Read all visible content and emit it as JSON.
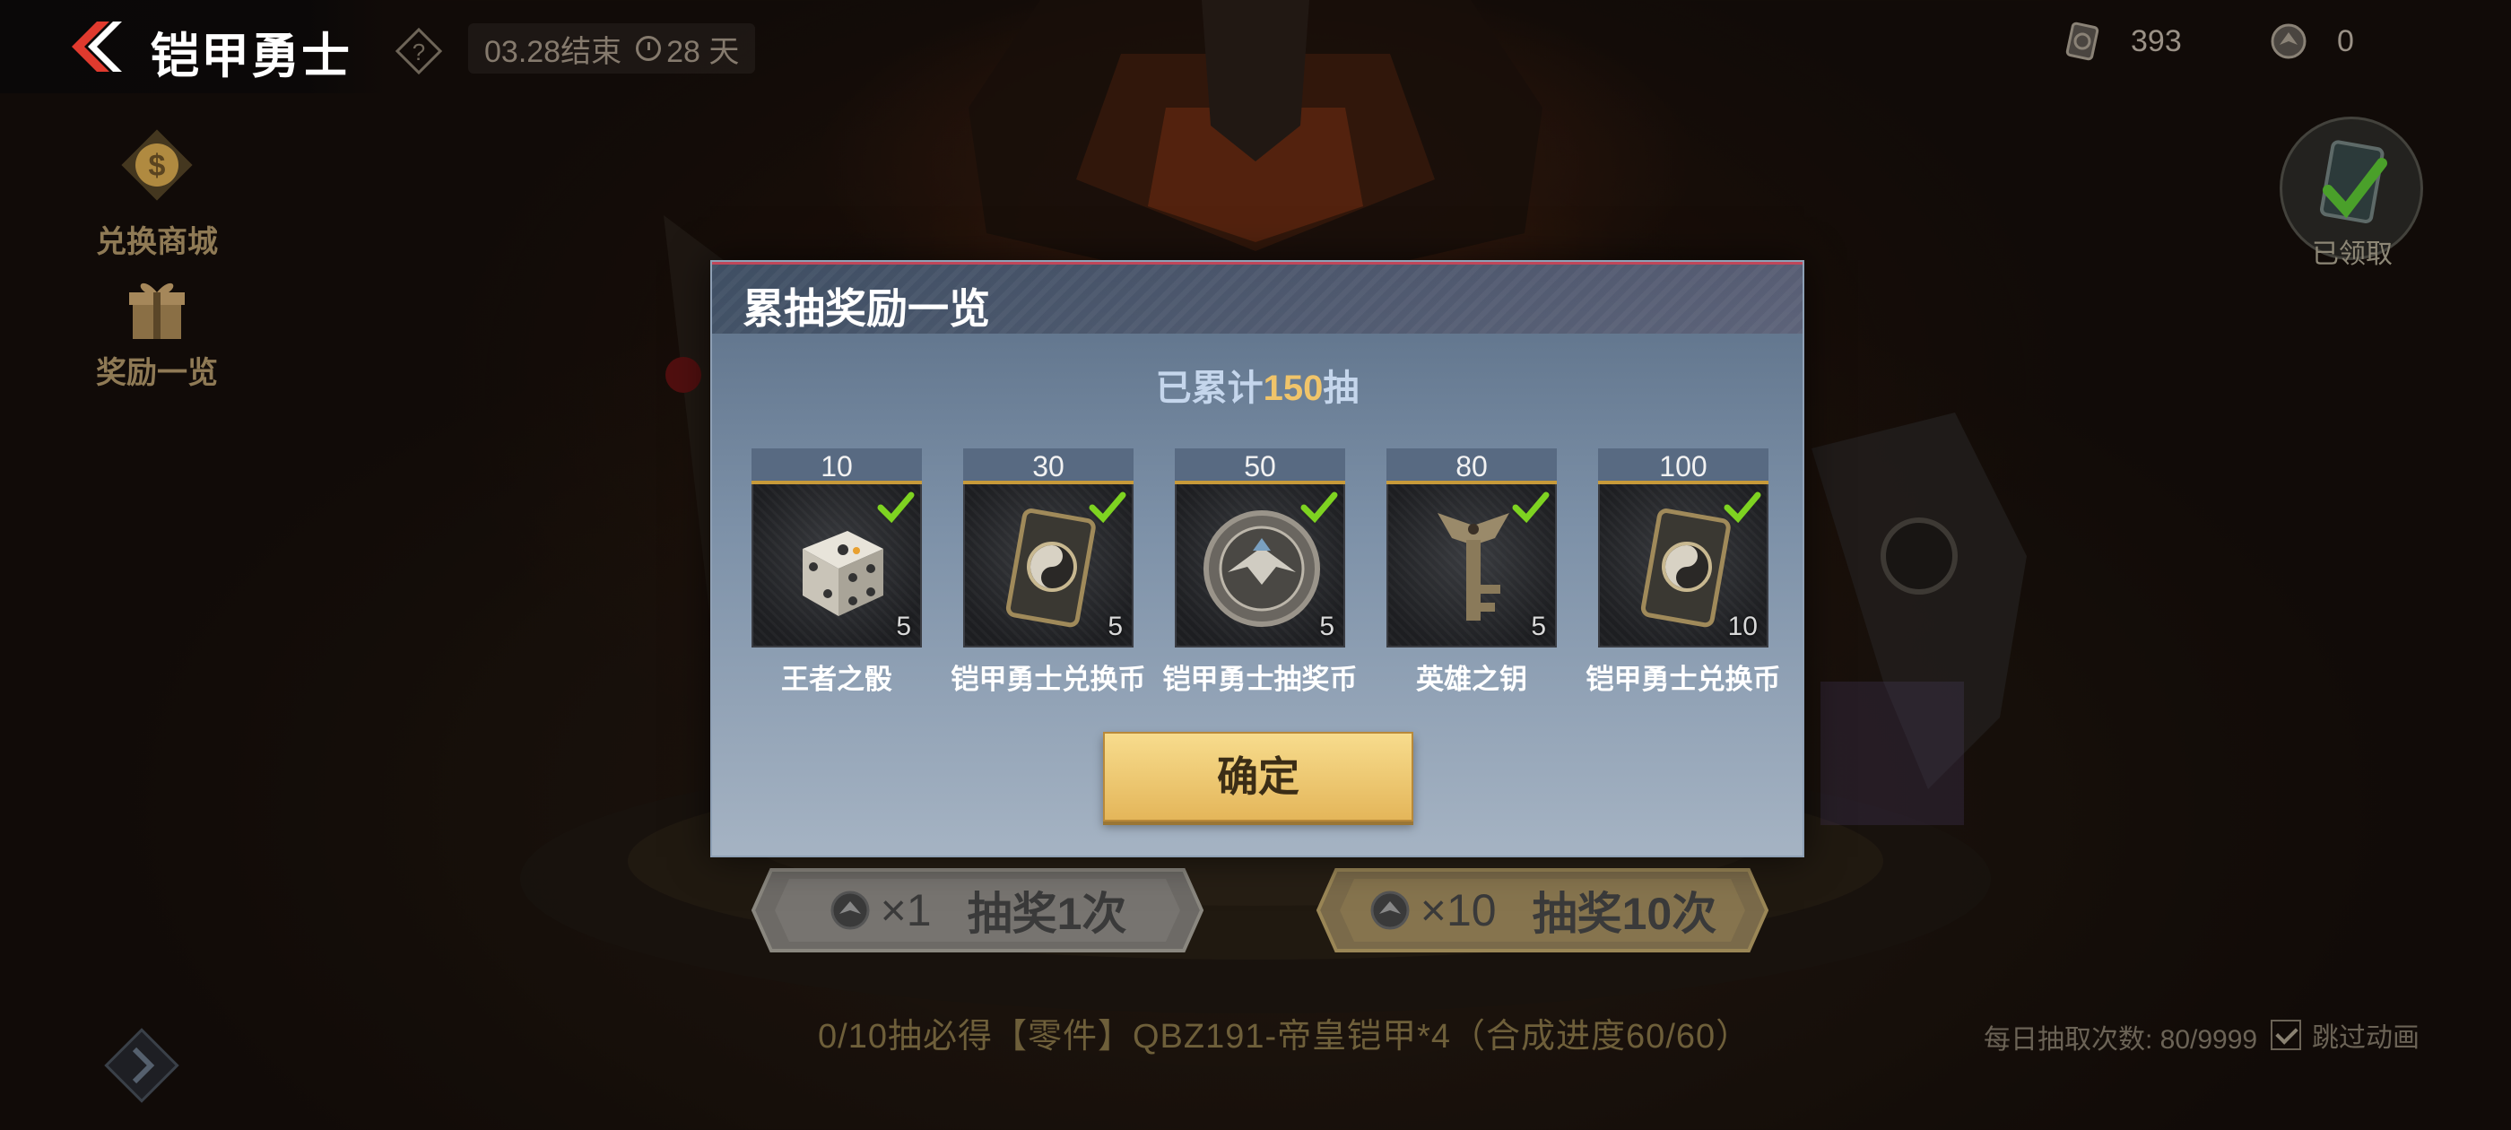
{
  "header": {
    "title": "铠甲勇士",
    "end_date": "03.28结束",
    "days_left": "28 天"
  },
  "currencies": [
    {
      "icon": "exchange-coin-icon",
      "value": "393"
    },
    {
      "icon": "draw-coin-icon",
      "value": "0"
    }
  ],
  "left_menu": [
    {
      "label": "兑换商城",
      "icon": "dollar-diamond-icon"
    },
    {
      "label": "奖励一览",
      "icon": "gift-icon"
    }
  ],
  "claimed_badge": {
    "label": "已领取"
  },
  "draw_buttons": {
    "single": {
      "multiplier": "×1",
      "label": "抽奖1次"
    },
    "ten": {
      "multiplier": "×10",
      "label": "抽奖10次"
    }
  },
  "footer": {
    "guarantee": "0/10抽必得【零件】QBZ191-帝皇铠甲*4（合成进度60/60）",
    "daily_count": "每日抽取次数: 80/9999",
    "skip_animation": "跳过动画"
  },
  "modal": {
    "title": "累抽奖励一览",
    "count_prefix": "已累计",
    "count_value": "150",
    "count_suffix": "抽",
    "confirm_label": "确定",
    "rewards": [
      {
        "threshold": "10",
        "name": "王者之骰",
        "qty": "5",
        "icon": "dice-icon",
        "claimed": true
      },
      {
        "threshold": "30",
        "name": "铠甲勇士兑换币",
        "qty": "5",
        "icon": "card-coin-icon",
        "claimed": true
      },
      {
        "threshold": "50",
        "name": "铠甲勇士抽奖币",
        "qty": "5",
        "icon": "eagle-coin-icon",
        "claimed": true
      },
      {
        "threshold": "80",
        "name": "英雄之钥",
        "qty": "5",
        "icon": "key-icon",
        "claimed": true
      },
      {
        "threshold": "100",
        "name": "铠甲勇士兑换币",
        "qty": "10",
        "icon": "card-coin-icon",
        "claimed": true
      }
    ]
  },
  "colors": {
    "accent_gold": "#f0c46a",
    "confirm_button": "#e4b65a",
    "check_green": "#7ed321",
    "back_red": "#e03a2e"
  }
}
